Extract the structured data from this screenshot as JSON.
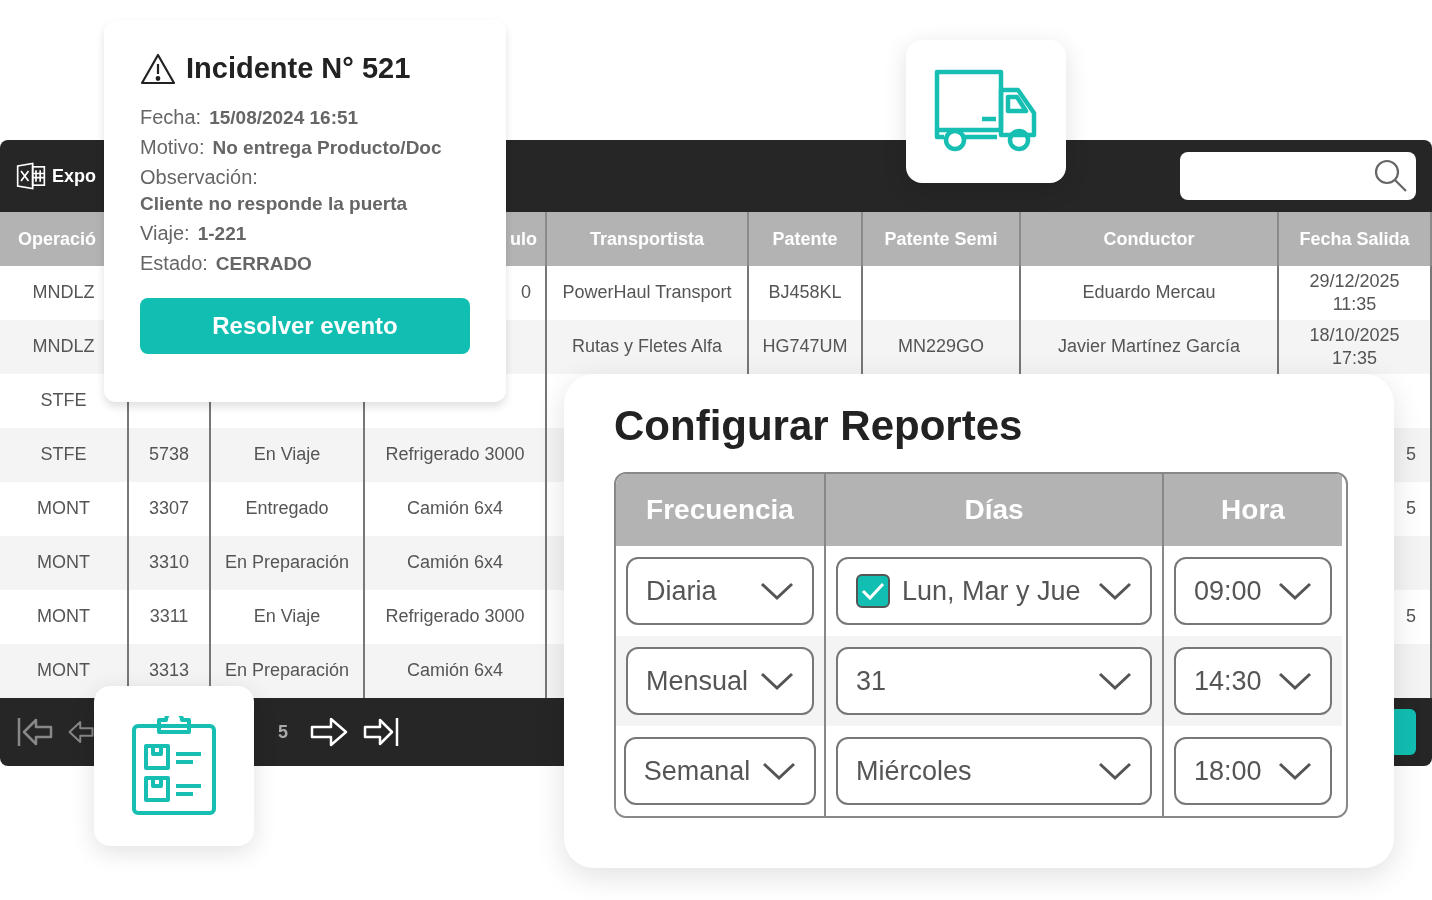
{
  "toolbar": {
    "export_label": "Expo"
  },
  "table": {
    "columns": [
      {
        "text": "Operació",
        "kind": "head"
      },
      null,
      null,
      {
        "text": "ulo",
        "kind": "tail"
      },
      "Transportista",
      "Patente",
      "Patente Semi",
      "Conductor",
      "Fecha Salida"
    ],
    "rows": [
      [
        "MNDLZ",
        null,
        null,
        {
          "text": "0",
          "kind": "tail"
        },
        "PowerHaul Transport",
        "BJ458KL",
        null,
        "Eduardo Mercau",
        "29/12/2025 11:35"
      ],
      [
        "MNDLZ",
        null,
        null,
        null,
        "Rutas y Fletes Alfa",
        "HG747UM",
        "MN229GO",
        "Javier Martínez García",
        "18/10/2025 17:35"
      ],
      [
        "STFE",
        null,
        null,
        null,
        null,
        null,
        null,
        null,
        null
      ],
      [
        "STFE",
        "5738",
        "En Viaje",
        "Refrigerado 3000",
        null,
        null,
        null,
        null,
        {
          "text": "5",
          "kind": "tail"
        }
      ],
      [
        "MONT",
        "3307",
        "Entregado",
        "Camión 6x4",
        null,
        null,
        null,
        null,
        {
          "text": "5",
          "kind": "tail"
        }
      ],
      [
        "MONT",
        "3310",
        "En Preparación",
        "Camión 6x4",
        null,
        null,
        null,
        null,
        null
      ],
      [
        "MONT",
        "3311",
        "En Viaje",
        "Refrigerado 3000",
        null,
        null,
        null,
        null,
        {
          "text": "5",
          "kind": "tail"
        }
      ],
      [
        "MONT",
        "3313",
        "En Preparación",
        "Camión 6x4",
        null,
        null,
        null,
        null,
        null
      ]
    ]
  },
  "pagination": {
    "page": "5"
  },
  "incident": {
    "title": "Incidente N° 521",
    "fields": [
      {
        "label": "Fecha:",
        "value": "15/08/2024 16:51",
        "kind": "inline"
      },
      {
        "label": "Motivo:",
        "value": "No entrega Producto/Doc",
        "kind": "inline"
      },
      {
        "label": "Observación:",
        "value": "Cliente no responde la puerta",
        "kind": "block"
      },
      {
        "label": "Viaje:",
        "value": "1-221",
        "kind": "inline"
      },
      {
        "label": "Estado:",
        "value": "CERRADO",
        "kind": "inline"
      }
    ],
    "button": "Resolver evento"
  },
  "report_config": {
    "title": "Configurar Reportes",
    "columns": [
      "Frecuencia",
      "Días",
      "Hora"
    ],
    "rows": [
      {
        "frecuencia": "Diaria",
        "dias": {
          "value": "Lun, Mar y Jue",
          "checked": true
        },
        "hora": "09:00"
      },
      {
        "frecuencia": "Mensual",
        "dias": {
          "value": "31"
        },
        "hora": "14:30"
      },
      {
        "frecuencia": "Semanal",
        "dias": {
          "value": "Miércoles"
        },
        "hora": "18:00"
      }
    ]
  }
}
